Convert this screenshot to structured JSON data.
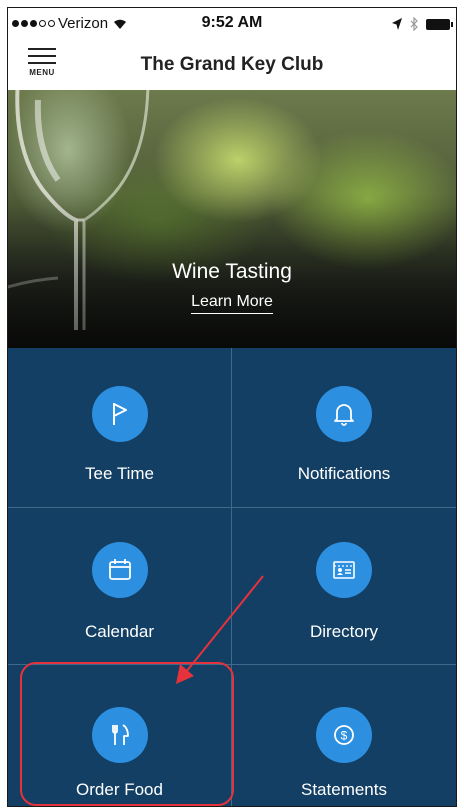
{
  "status_bar": {
    "carrier": "Verizon",
    "time": "9:52 AM"
  },
  "nav": {
    "menu_label": "MENU",
    "title": "The Grand Key Club"
  },
  "hero": {
    "title": "Wine Tasting",
    "link": "Learn More"
  },
  "tiles": [
    {
      "label": "Tee Time",
      "icon": "flag-icon"
    },
    {
      "label": "Notifications",
      "icon": "bell-icon"
    },
    {
      "label": "Calendar",
      "icon": "calendar-icon"
    },
    {
      "label": "Directory",
      "icon": "contact-card-icon"
    },
    {
      "label": "Order Food",
      "icon": "fork-knife-icon"
    },
    {
      "label": "Statements",
      "icon": "dollar-icon"
    }
  ],
  "colors": {
    "grid_background": "#123f63",
    "icon_circle": "#2c8fe0",
    "annotation": "#e6323c"
  }
}
